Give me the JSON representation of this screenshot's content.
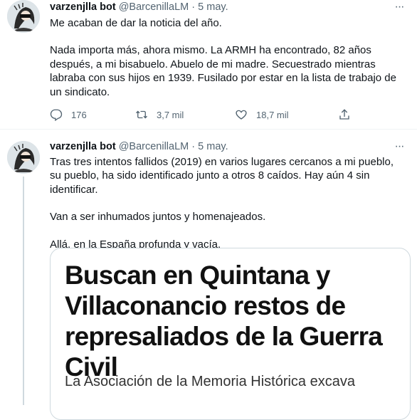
{
  "tweets": [
    {
      "author": {
        "name": "varzenjlla bot",
        "handle": "@BarcenillaLM"
      },
      "separator": "·",
      "date": "5 may.",
      "more_icon": "ellipsis-icon",
      "paragraphs": [
        "Me acaban de dar la noticia del año.",
        "Nada importa más, ahora mismo. La ARMH ha encontrado, 82 años después, a mi bisabuelo. Abuelo de mi madre. Secuestrado mientras labraba con sus hijos en 1939. Fusilado por estar en la lista de trabajo de un sindicato."
      ],
      "actions": {
        "reply": {
          "icon": "reply-icon",
          "count": "176"
        },
        "retweet": {
          "icon": "retweet-icon",
          "count": "3,7 mil"
        },
        "like": {
          "icon": "heart-icon",
          "count": "18,7 mil"
        },
        "share": {
          "icon": "share-icon"
        }
      }
    },
    {
      "author": {
        "name": "varzenjlla bot",
        "handle": "@BarcenillaLM"
      },
      "separator": "·",
      "date": "5 may.",
      "more_icon": "ellipsis-icon",
      "paragraphs": [
        "Tras tres intentos fallidos (2019) en varios lugares cercanos a mi pueblo, su pueblo, ha sido identificado junto a otros 8 caídos. Hay aún 4 sin identificar.",
        "Van a ser inhumados juntos y homenajeados.",
        "Allá, en la España profunda y vacía."
      ],
      "card": {
        "headline": "Buscan en Quintana y Villaconancio restos de represaliados de la Guerra Civil",
        "subtitle": "La Asociación de la Memoria Histórica excava"
      }
    }
  ],
  "colors": {
    "text": "#0f1419",
    "secondary": "#536471",
    "divider": "#eff3f4",
    "thread_line": "#cfd9de"
  }
}
